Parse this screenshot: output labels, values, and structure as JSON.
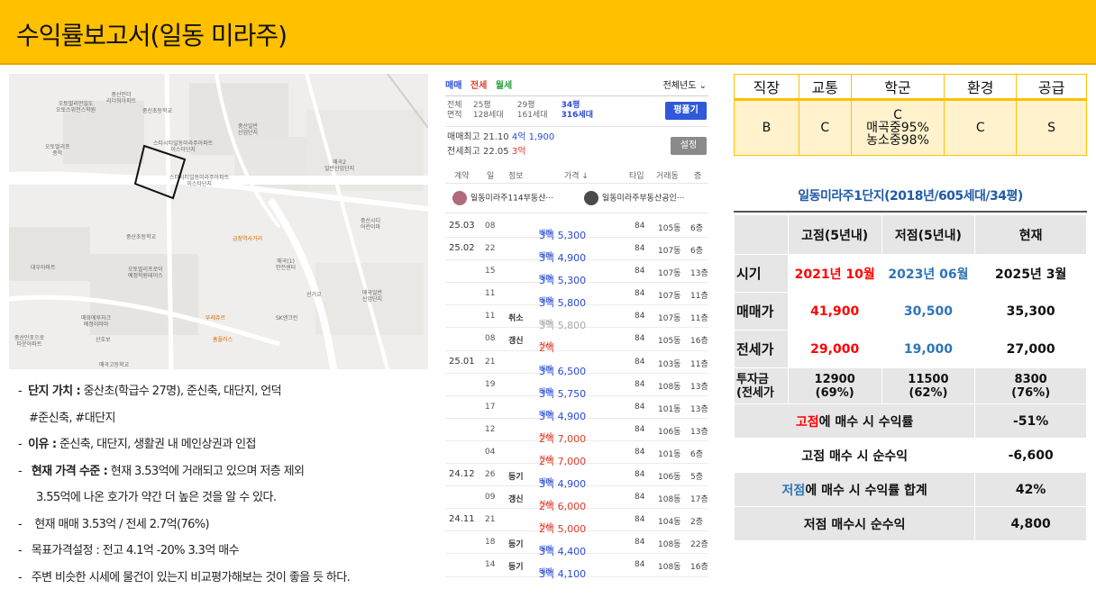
{
  "header": {
    "title": "수익률보고서(일동 미라주)"
  },
  "map": {
    "labels": [
      {
        "text": "중산인더\n리더워아파트",
        "style": "gray"
      },
      {
        "text": "오토멀리언일도\n오토스위전스학원",
        "style": "gray"
      },
      {
        "text": "중신초등학교",
        "style": "gray"
      },
      {
        "text": "오토멀리프\n중학",
        "style": "gray"
      },
      {
        "text": "중산일반\n산업단지",
        "style": "gray"
      },
      {
        "text": "스타시티일동미라주아파트\n이스타단지",
        "style": "gray"
      },
      {
        "text": "스타시티일동미라주아파트\n이스타단지",
        "style": "gray"
      },
      {
        "text": "매곡2\n일반산업단지",
        "style": "gray"
      },
      {
        "text": "중산초등학교",
        "style": "gray"
      },
      {
        "text": "금정역사거리",
        "style": "orange"
      },
      {
        "text": "중산시디\n어린이마",
        "style": "gray"
      },
      {
        "text": "대우아파트",
        "style": "gray"
      },
      {
        "text": "오토멀리프로이\n예정학원테이스",
        "style": "gray"
      },
      {
        "text": "매곡(1)\n안전센터",
        "style": "gray"
      },
      {
        "text": "선거교",
        "style": "gray"
      },
      {
        "text": "매곡일반\n산업단지",
        "style": "gray"
      },
      {
        "text": "매화에루차크\n예정이마마",
        "style": "gray"
      },
      {
        "text": "뚜레쥬르",
        "style": "orange"
      },
      {
        "text": "SK엔크린",
        "style": "gray"
      },
      {
        "text": "중산만포으로\n타운아파트",
        "style": "gray"
      },
      {
        "text": "산호보",
        "style": "gray"
      },
      {
        "text": "홈플러스",
        "style": "orange"
      },
      {
        "text": "매곡고등학교",
        "style": "gray"
      }
    ]
  },
  "notes": {
    "line1_label": "단지 가치 :",
    "line1_text": "중산초(학급수 27명), 준신축, 대단지, 언덕",
    "line1_cont": "#준신축, #대단지",
    "line2_label": "이유 :",
    "line2_text": "준신축, 대단지, 생활권 내 메인상권과 인접",
    "line3_label": "현재 가격 수준 :",
    "line3_text": "현재 3.53억에 거래되고 있으며 저층 제외",
    "line3_cont": "3.55억에 나온 호가가 약간 더 높은 것을 알 수 있다.",
    "line4": "현재 매매 3.53억 / 전세 2.7억(76%)",
    "line5": "목표가격설정 : 전고 4.1억 -20% 3.3억 매수",
    "line6": "주변 비슷한 시세에 물건이 있는지 비교평가해보는 것이 좋을 듯 하다.",
    "bullet": "-"
  },
  "listing": {
    "tabs": [
      {
        "label": "매매",
        "color": "#2a4bd7"
      },
      {
        "label": "전세",
        "color": "#e03a2a"
      },
      {
        "label": "월세",
        "color": "#2a9d3a"
      }
    ],
    "year_select": "전체년도 ⌄",
    "sizes_label1": "전체",
    "sizes_label2": "면적",
    "sizes": [
      {
        "py": "25평",
        "units": "128세대"
      },
      {
        "py": "29평",
        "units": "161세대"
      },
      {
        "py": "34평",
        "units": "316세대"
      }
    ],
    "pyeong_button": "평풀기",
    "hist_buy_label": "매매최고",
    "hist_buy_date": "21.10",
    "hist_buy_price": "4억 1,900",
    "hist_jeon_label": "전세최고",
    "hist_jeon_date": "22.05",
    "hist_jeon_price": "3억",
    "set_button": "설정",
    "columns": [
      "계약",
      "일",
      "정보",
      "가격 ↓",
      "타입",
      "거래동",
      "층"
    ],
    "agent1": "일동미라주114부동산···",
    "agent2": "일동미라주부동산공인···",
    "rows": [
      {
        "date": "25.03",
        "day": "08",
        "info": "",
        "type": "매매",
        "amt": "3억 5,300",
        "size": "84",
        "bldg": "105동",
        "floor": "6층",
        "kind": "buy"
      },
      {
        "date": "25.02",
        "day": "22",
        "info": "",
        "type": "매매",
        "amt": "3억 4,900",
        "size": "84",
        "bldg": "107동",
        "floor": "6층",
        "kind": "buy"
      },
      {
        "date": "",
        "day": "15",
        "info": "",
        "type": "매매",
        "amt": "3억 5,300",
        "size": "84",
        "bldg": "107동",
        "floor": "13층",
        "kind": "buy"
      },
      {
        "date": "",
        "day": "11",
        "info": "",
        "type": "매매",
        "amt": "3억 5,800",
        "size": "84",
        "bldg": "107동",
        "floor": "11층",
        "kind": "buy"
      },
      {
        "date": "",
        "day": "11",
        "info": "취소",
        "type": "매매",
        "amt": "3억 5,800",
        "size": "84",
        "bldg": "107동",
        "floor": "11층",
        "kind": "cancel"
      },
      {
        "date": "",
        "day": "08",
        "info": "갱신",
        "type": "전세",
        "amt": "2억",
        "size": "84",
        "bldg": "105동",
        "floor": "16층",
        "kind": "jeon"
      },
      {
        "date": "25.01",
        "day": "21",
        "info": "",
        "type": "매매",
        "amt": "3억 6,500",
        "size": "84",
        "bldg": "103동",
        "floor": "11층",
        "kind": "buy"
      },
      {
        "date": "",
        "day": "19",
        "info": "",
        "type": "매매",
        "amt": "3억 5,750",
        "size": "84",
        "bldg": "108동",
        "floor": "13층",
        "kind": "buy"
      },
      {
        "date": "",
        "day": "17",
        "info": "",
        "type": "매매",
        "amt": "3억 4,900",
        "size": "84",
        "bldg": "101동",
        "floor": "13층",
        "kind": "buy"
      },
      {
        "date": "",
        "day": "12",
        "info": "",
        "type": "전세",
        "amt": "2억 7,000",
        "size": "84",
        "bldg": "106동",
        "floor": "13층",
        "kind": "jeon"
      },
      {
        "date": "",
        "day": "04",
        "info": "",
        "type": "전세",
        "amt": "2억 7,000",
        "size": "84",
        "bldg": "101동",
        "floor": "6층",
        "kind": "jeon"
      },
      {
        "date": "24.12",
        "day": "26",
        "info": "등기",
        "type": "매매",
        "amt": "3억 4,900",
        "size": "84",
        "bldg": "106동",
        "floor": "5층",
        "kind": "buy"
      },
      {
        "date": "",
        "day": "09",
        "info": "갱신",
        "type": "전세",
        "amt": "2억 6,000",
        "size": "84",
        "bldg": "108동",
        "floor": "17층",
        "kind": "jeon"
      },
      {
        "date": "24.11",
        "day": "21",
        "info": "",
        "type": "전세",
        "amt": "2억 5,000",
        "size": "84",
        "bldg": "104동",
        "floor": "2층",
        "kind": "jeon"
      },
      {
        "date": "",
        "day": "18",
        "info": "등기",
        "type": "매매",
        "amt": "3억 4,400",
        "size": "84",
        "bldg": "108동",
        "floor": "22층",
        "kind": "buy"
      },
      {
        "date": "",
        "day": "14",
        "info": "등기",
        "type": "매매",
        "amt": "3억 4,100",
        "size": "84",
        "bldg": "108동",
        "floor": "16층",
        "kind": "buy"
      }
    ]
  },
  "score": {
    "headers": [
      "직장",
      "교통",
      "학군",
      "환경",
      "공급"
    ],
    "values": [
      "B",
      "C",
      "C\n매곡중95%\n농소중98%",
      "C",
      "S"
    ]
  },
  "returns": {
    "title": "일동미라주1단지(2018년/605세대/34평)",
    "col_high": "고점(5년내)",
    "col_low": "저점(5년내)",
    "col_now": "현재",
    "rows": [
      {
        "label": "시기",
        "high": "2021년 10월",
        "low": "2023년 06월",
        "now": "2025년 3월"
      },
      {
        "label": "매매가",
        "high": "41,900",
        "low": "30,500",
        "now": "35,300"
      },
      {
        "label": "전세가",
        "high": "29,000",
        "low": "19,000",
        "now": "27,000"
      },
      {
        "label": "투자금\n(전세가",
        "high": "12900\n(69%)",
        "low": "11500\n(62%)",
        "now": "8300\n(76%)"
      }
    ],
    "summary": [
      {
        "pre": "고점",
        "post": "에 매수 시 수익률",
        "value": "-51%",
        "pre_color": "red"
      },
      {
        "pre": "",
        "post": "고점 매수 시 순수익",
        "value": "-6,600",
        "pre_color": ""
      },
      {
        "pre": "저점",
        "post": "에 매수 시 수익률 합계",
        "value": "42%",
        "pre_color": "blue"
      },
      {
        "pre": "",
        "post": "저점 매수시 순수익",
        "value": "4,800",
        "pre_color": ""
      }
    ]
  }
}
